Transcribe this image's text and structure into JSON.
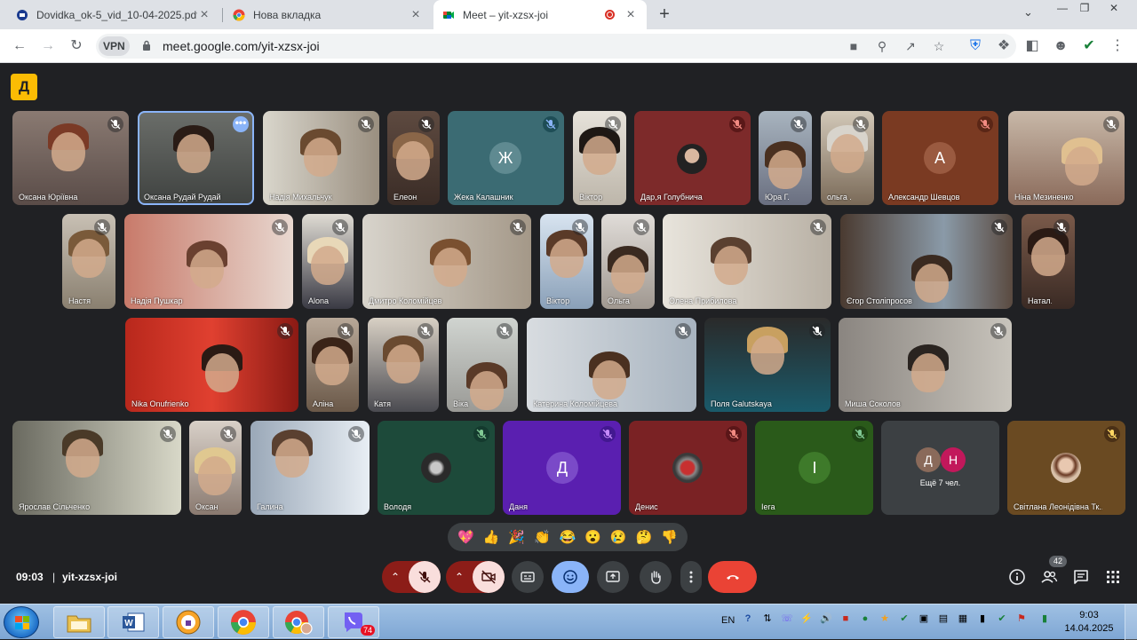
{
  "browser": {
    "tabs": [
      {
        "label": "Dovidka_ok-5_vid_10-04-2025.pdf",
        "icon": "pdf-icon"
      },
      {
        "label": "Нова вкладка",
        "icon": "chrome-icon"
      },
      {
        "label": "Meet – yit-xzsx-joi",
        "icon": "meet-icon",
        "recording": true
      }
    ],
    "new_tab": "+",
    "url": "meet.google.com/yit-xzsx-joi",
    "vpn_label": "VPN"
  },
  "meet": {
    "time": "09:03",
    "separator": "|",
    "meeting_code": "yit-xzsx-joi",
    "participant_count": "42",
    "logo_glyph": "Д",
    "participants": {
      "p1": "Оксана Юріївна",
      "p2": "Оксана Рудай Рудай",
      "p3": "Надія Михальчук",
      "p4": "Елеон...",
      "p5": "Жека Калашник",
      "p5_initial": "Ж",
      "p6": "Віктор...",
      "p7": "Дар,я Голубнича",
      "p8": "Юра Г...",
      "p9": "ольга ...",
      "p10": "Александр Шевцов",
      "p10_initial": "А",
      "p11": "Ніна Мезиненко",
      "p12": "Настя",
      "p13": "Надія Пушкар",
      "p14": "Alona ...",
      "p15": "Дмитро Коломійцев",
      "p16": "Віктор...",
      "p17": "Ольга ...",
      "p18": "Олена Прибилова",
      "p19": "Єгор Століпросов",
      "p20": "Натал...",
      "p21": "Nika Onufrienko",
      "p22": "Аліна",
      "p23": "Катя",
      "p24": "Віка",
      "p25": "Катерина Коломійцева",
      "p26": "Поля Galutskaya",
      "p27": "Миша Соколов",
      "p28": "Ярослав Сільченко",
      "p29": "Оксан...",
      "p30": "Галина",
      "p31": "Володя",
      "p32": "Даня",
      "p32_initial": "Д",
      "p33": "Денис",
      "p34": "Iera",
      "p34_initial": "I",
      "p35_av1": "Д",
      "p35_av2": "Н",
      "others": "Ещё 7 чел.",
      "p36": "Світлана Леонідівна Тк..."
    },
    "reactions": [
      "💖",
      "👍",
      "🎉",
      "👏",
      "😂",
      "😮",
      "😢",
      "🤔",
      "👎"
    ]
  },
  "taskbar": {
    "lang": "EN",
    "clock_time": "9:03",
    "clock_date": "14.04.2025",
    "viber_badge": "74"
  }
}
